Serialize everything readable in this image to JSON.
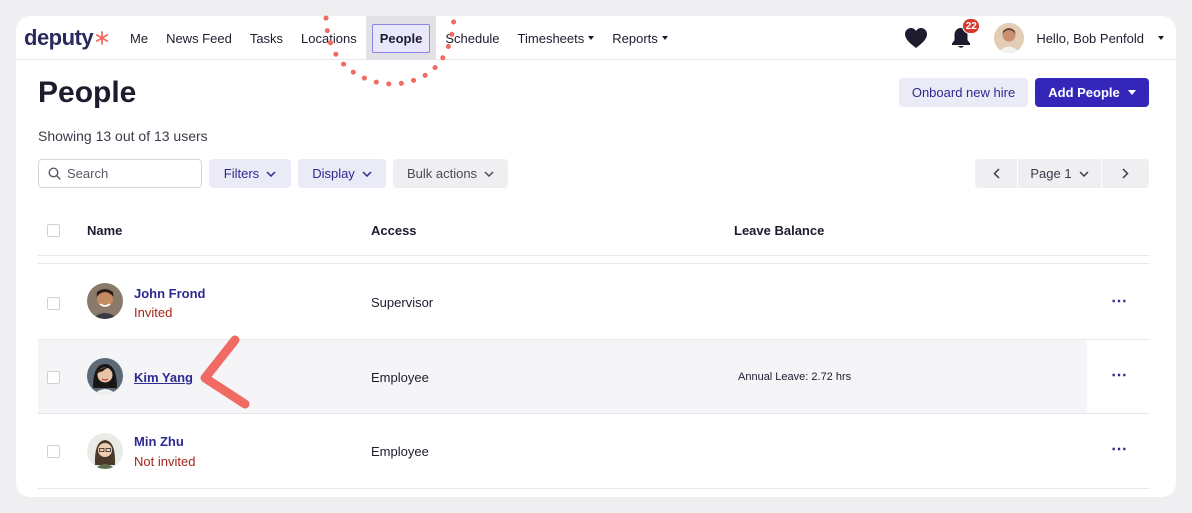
{
  "app": {
    "brand": "deputy",
    "brand_color": "#2b2a5e",
    "accent_color": "#3326b8"
  },
  "nav": {
    "items": [
      {
        "label": "Me"
      },
      {
        "label": "News Feed"
      },
      {
        "label": "Tasks"
      },
      {
        "label": "Locations"
      },
      {
        "label": "People",
        "active": true
      },
      {
        "label": "Schedule"
      },
      {
        "label": "Timesheets",
        "has_dropdown": true
      },
      {
        "label": "Reports",
        "has_dropdown": true
      }
    ],
    "notification_count": "22",
    "greeting": "Hello, Bob Penfold",
    "icons": [
      "heart-icon",
      "bell-icon",
      "chevron-down-icon"
    ]
  },
  "page": {
    "title": "People",
    "count_text": "Showing 13 out of 13 users",
    "onboard_label": "Onboard new hire",
    "add_label": "Add People"
  },
  "toolbar": {
    "search_placeholder": "Search",
    "filters_label": "Filters",
    "display_label": "Display",
    "bulk_label": "Bulk actions",
    "page_label": "Page 1"
  },
  "table": {
    "headers": [
      "Name",
      "Access",
      "Leave Balance"
    ],
    "rows": [
      {
        "name": "John Frond",
        "status": "Invited",
        "access": "Supervisor",
        "leave": "",
        "status_color": "#a2251c"
      },
      {
        "name": "Kim Yang",
        "status": "",
        "access": "Employee",
        "leave": "Annual Leave: 2.72 hrs",
        "highlighted": true
      },
      {
        "name": "Min Zhu",
        "status": "Not invited",
        "access": "Employee",
        "leave": "",
        "status_color": "#a2251c"
      }
    ],
    "row_menu_glyph": "⋯"
  },
  "annotations": {
    "color": "#f06b63"
  }
}
